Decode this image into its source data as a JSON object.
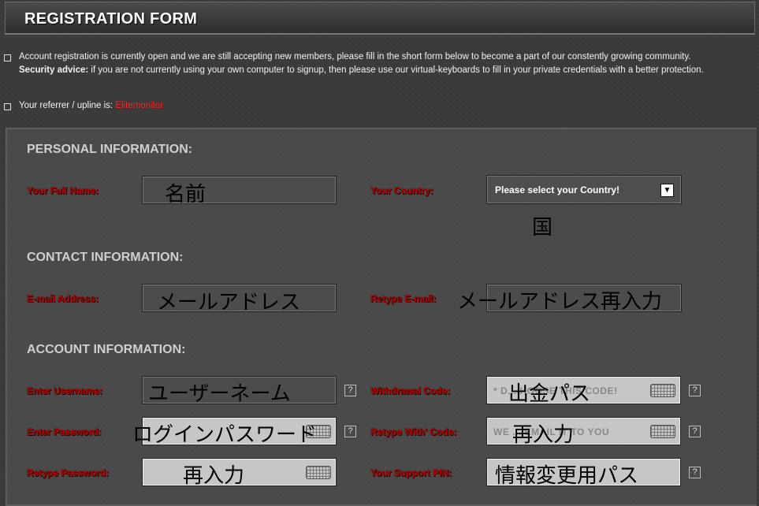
{
  "header": {
    "title": "REGISTRATION FORM"
  },
  "notice": {
    "text": "Account registration is currently open and we are still accepting new members, please fill in the short form below to become a part of our constently growing community.",
    "security_label": "Security advice:",
    "security_text": "if you are not currently using your own computer to signup, then please use our virtual-keyboards to fill in your private credentials with a better protection."
  },
  "referrer": {
    "label": "Your referrer / upline is:",
    "name": "Elitemonitor"
  },
  "sections": {
    "personal": "PERSONAL INFORMATION:",
    "contact": "CONTACT INFORMATION:",
    "account": "ACCOUNT INFORMATION:"
  },
  "fields": {
    "full_name": {
      "label": "Your Full Name:",
      "value": "名前"
    },
    "country": {
      "label": "Your Country:",
      "selected": "Please select your Country!",
      "note": "国"
    },
    "email": {
      "label": "E-mail Address:",
      "value": "メールアドレス"
    },
    "retype_email": {
      "label": "Retype E-mail:",
      "value": "メールアドレス再入力"
    },
    "username": {
      "label": "Enter Username:",
      "value": "ユーザーネーム"
    },
    "password": {
      "label": "Enter Password:",
      "value": "ログインパスワード"
    },
    "retype_password": {
      "label": "Retype Password:",
      "value": "再入力"
    },
    "withdrawal_code": {
      "label": "Withdrawal Code:",
      "placeholder": "* D... HOOSE THIS CODE!",
      "value": "出金パス"
    },
    "retype_withdrawal": {
      "label": "Retype With' Code:",
      "placeholder": "WE ... EMAIL IT TO YOU",
      "value": "再入力"
    },
    "support_pin": {
      "label": "Your Support PIN:",
      "value": "情報変更用パス"
    }
  },
  "help_glyph": "?",
  "arrow_glyph": "▼",
  "icons": {
    "keyboard": "keyboard-icon",
    "help": "help-icon"
  }
}
